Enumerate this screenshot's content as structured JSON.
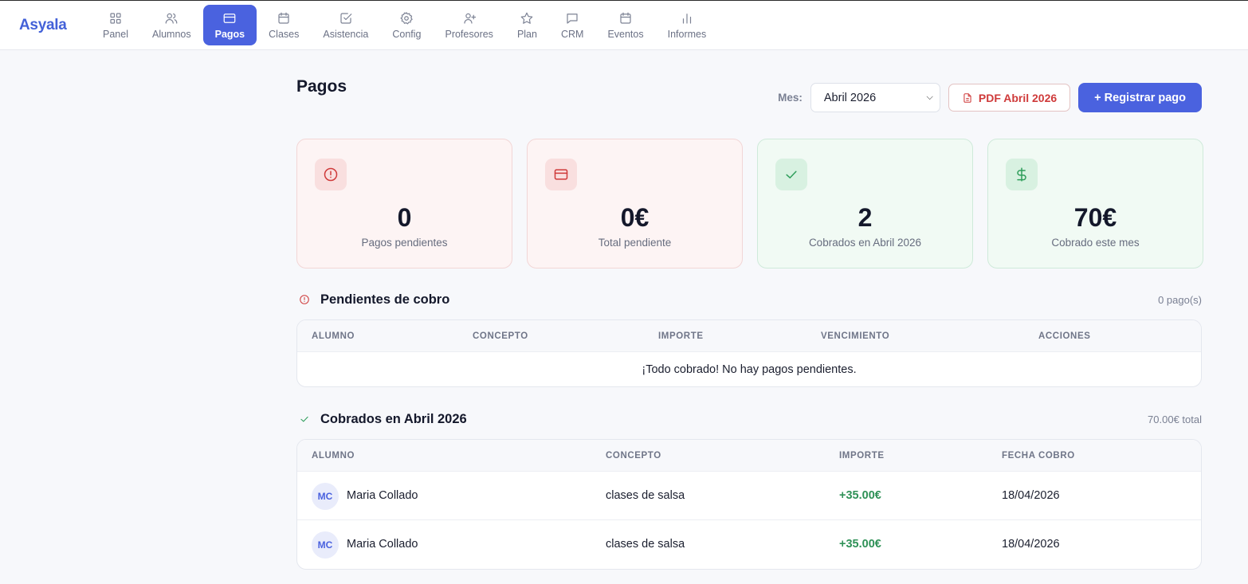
{
  "brand": "Asyala",
  "nav": [
    {
      "label": "Panel",
      "icon": "grid-icon"
    },
    {
      "label": "Alumnos",
      "icon": "users-icon"
    },
    {
      "label": "Pagos",
      "icon": "credit-card-icon",
      "active": true
    },
    {
      "label": "Clases",
      "icon": "calendar-icon"
    },
    {
      "label": "Asistencia",
      "icon": "check-square-icon"
    },
    {
      "label": "Config",
      "icon": "gear-icon"
    },
    {
      "label": "Profesores",
      "icon": "user-plus-icon"
    },
    {
      "label": "Plan",
      "icon": "star-icon"
    },
    {
      "label": "CRM",
      "icon": "message-icon"
    },
    {
      "label": "Eventos",
      "icon": "calendar-icon"
    },
    {
      "label": "Informes",
      "icon": "bar-chart-icon"
    }
  ],
  "page": {
    "title": "Pagos",
    "month_label": "Mes:",
    "month_value": "Abril 2026",
    "pdf_button": "PDF Abril 2026",
    "add_button": "+ Registrar pago"
  },
  "stats": [
    {
      "value": "0",
      "label": "Pagos pendientes",
      "icon": "alert-circle-icon",
      "tone": "red"
    },
    {
      "value": "0€",
      "label": "Total pendiente",
      "icon": "credit-card-icon",
      "tone": "red"
    },
    {
      "value": "2",
      "label": "Cobrados en Abril 2026",
      "icon": "check-icon",
      "tone": "green"
    },
    {
      "value": "70€",
      "label": "Cobrado este mes",
      "icon": "dollar-icon",
      "tone": "green"
    }
  ],
  "pending": {
    "title": "Pendientes de cobro",
    "count": "0 pago(s)",
    "columns": [
      "ALUMNO",
      "CONCEPTO",
      "IMPORTE",
      "VENCIMIENTO",
      "ACCIONES"
    ],
    "empty_message": "¡Todo cobrado! No hay pagos pendientes."
  },
  "collected": {
    "title": "Cobrados en Abril 2026",
    "total": "70.00€ total",
    "columns": [
      "ALUMNO",
      "CONCEPTO",
      "IMPORTE",
      "FECHA COBRO"
    ],
    "rows": [
      {
        "initials": "MC",
        "name": "Maria Collado",
        "concept": "clases de salsa",
        "amount": "+35.00€",
        "date": "18/04/2026"
      },
      {
        "initials": "MC",
        "name": "Maria Collado",
        "concept": "clases de salsa",
        "amount": "+35.00€",
        "date": "18/04/2026"
      }
    ]
  },
  "colors": {
    "accent": "#4a62df",
    "danger": "#cf3a3a",
    "success": "#2f9157"
  }
}
